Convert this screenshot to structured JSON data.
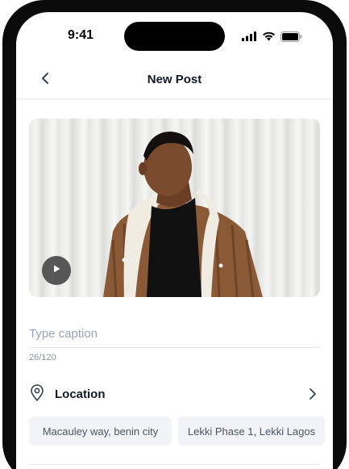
{
  "status_bar": {
    "time": "9:41"
  },
  "header": {
    "title": "New Post"
  },
  "media": {
    "type": "video"
  },
  "caption": {
    "placeholder": "Type caption",
    "value": "",
    "counter": "26/120"
  },
  "location": {
    "label": "Location",
    "suggestions": [
      "Macauley way, benin city",
      "Lekki Phase 1, Lekki Lagos"
    ]
  },
  "colors": {
    "accent_text": "#111827",
    "chip_bg": "#f2f3f6",
    "placeholder": "#9aa3b5"
  },
  "icons": {
    "back": "chevron-left-icon",
    "play": "play-icon",
    "location": "map-pin-icon",
    "forward": "chevron-right-icon",
    "signal": "cellular-signal-icon",
    "wifi": "wifi-icon",
    "battery": "battery-icon"
  }
}
